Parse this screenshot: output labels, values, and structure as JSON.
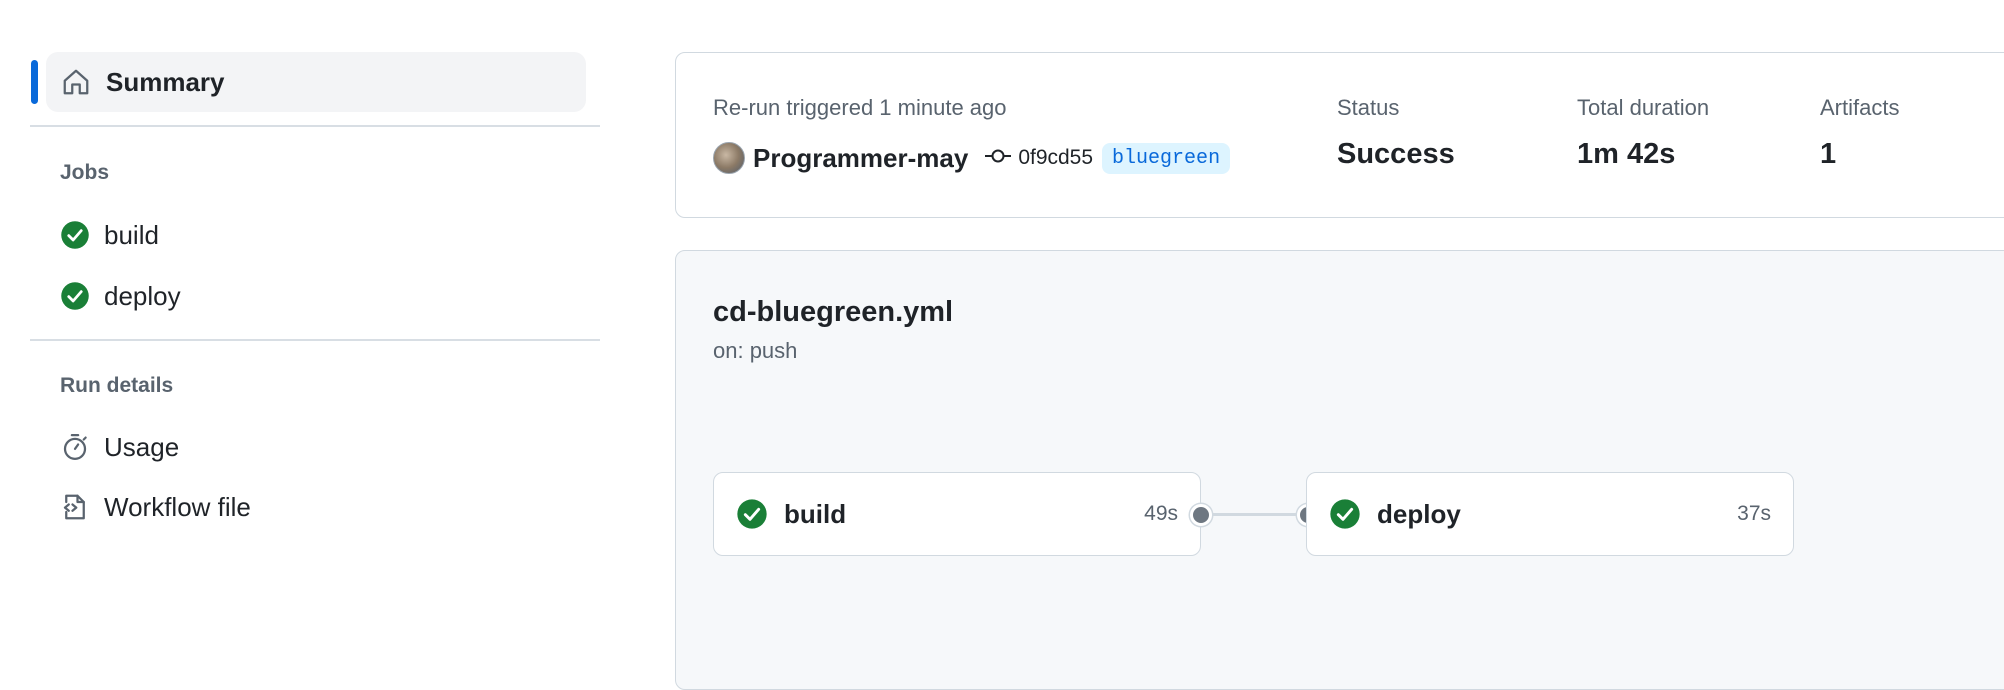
{
  "sidebar": {
    "summary_label": "Summary",
    "jobs_heading": "Jobs",
    "jobs": [
      {
        "label": "build",
        "status_icon": "check-circle-icon"
      },
      {
        "label": "deploy",
        "status_icon": "check-circle-icon"
      }
    ],
    "run_details_heading": "Run details",
    "details": [
      {
        "label": "Usage",
        "icon": "stopwatch-icon"
      },
      {
        "label": "Workflow file",
        "icon": "file-code-icon"
      }
    ]
  },
  "run": {
    "trigger_text": "Re-run triggered 1 minute ago",
    "actor": "Programmer-may",
    "commit": "0f9cd55",
    "branch": "bluegreen",
    "status_label": "Status",
    "status_value": "Success",
    "duration_label": "Total duration",
    "duration_value": "1m 42s",
    "artifacts_label": "Artifacts",
    "artifacts_value": "1"
  },
  "workflow": {
    "file_name": "cd-bluegreen.yml",
    "trigger": "on: push",
    "jobs": [
      {
        "name": "build",
        "duration": "49s"
      },
      {
        "name": "deploy",
        "duration": "37s"
      }
    ]
  },
  "colors": {
    "accent": "#0969da",
    "success": "#1a7f37",
    "muted_text": "#59636e",
    "border": "#d1d9e0",
    "panel_bg": "#f6f8fa"
  }
}
